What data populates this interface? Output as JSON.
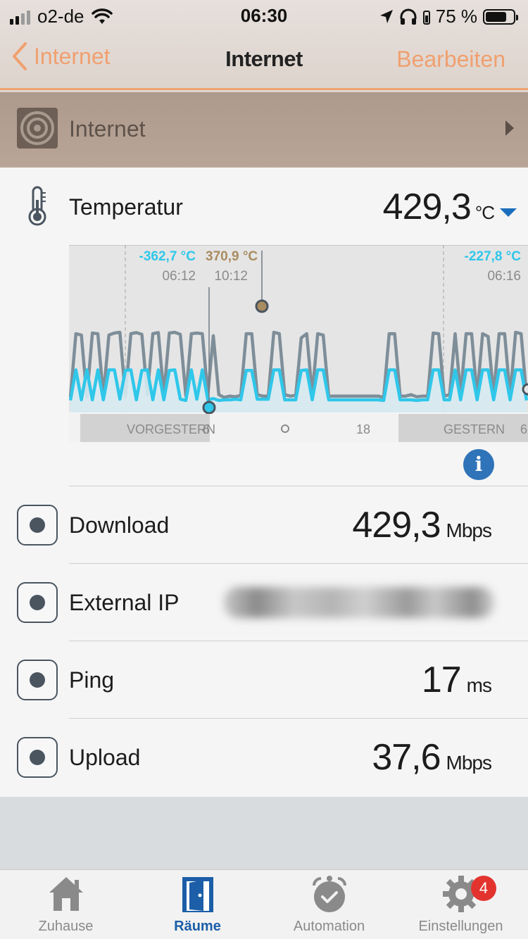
{
  "status_bar": {
    "carrier": "o2-de",
    "time": "06:30",
    "battery_percent": "75 %",
    "battery_level": 0.75
  },
  "nav": {
    "back_label": "Internet",
    "title": "Internet",
    "edit_label": "Bearbeiten"
  },
  "room": {
    "name": "Internet"
  },
  "temperature": {
    "label": "Temperatur",
    "value": "429,3",
    "unit": "°C"
  },
  "chart_data": {
    "type": "line",
    "markers": [
      {
        "value_label": "-362,7 °C",
        "time_label": "06:12",
        "color": "#2fc7ea"
      },
      {
        "value_label": "370,9 °C",
        "time_label": "10:12",
        "color": "#a98c60"
      },
      {
        "value_label": "-227,8 °C",
        "time_label": "06:16",
        "color": "#2fc7ea"
      }
    ],
    "timeline_labels": [
      "VORGESTERN",
      "6",
      "18",
      "GESTERN",
      "6"
    ],
    "series": [
      {
        "color": "#7e8e99",
        "values": [
          10,
          470,
          460,
          10,
          475,
          470,
          20,
          460,
          475,
          480,
          20,
          470,
          478,
          465,
          30,
          470,
          478,
          30,
          475,
          480,
          465,
          20,
          470,
          475,
          470,
          30,
          455,
          30,
          10,
          20,
          15,
          25,
          470,
          470,
          30,
          20,
          20,
          480,
          470,
          30,
          20,
          25,
          440,
          470,
          30,
          470,
          460,
          20,
          20,
          20,
          20,
          20,
          20,
          20,
          20,
          20,
          20,
          10,
          470,
          470,
          20,
          20,
          30,
          15,
          20,
          20,
          475,
          470,
          20,
          30,
          470,
          30,
          470,
          470,
          20,
          470,
          450,
          30,
          470,
          470,
          20,
          480,
          470,
          20
        ]
      },
      {
        "color": "#2fc7ea",
        "values": [
          30,
          520,
          40,
          520,
          40,
          520,
          40,
          520,
          520,
          50,
          510,
          520,
          40,
          510,
          520,
          40,
          520,
          40,
          510,
          520,
          50,
          30,
          520,
          50,
          520,
          40,
          60,
          30,
          40,
          40,
          50,
          40,
          510,
          510,
          50,
          50,
          50,
          520,
          520,
          40,
          40,
          40,
          510,
          520,
          40,
          520,
          520,
          40,
          40,
          40,
          40,
          40,
          40,
          40,
          40,
          40,
          40,
          30,
          520,
          520,
          40,
          40,
          40,
          30,
          40,
          40,
          520,
          520,
          40,
          40,
          520,
          40,
          520,
          520,
          40,
          520,
          520,
          40,
          520,
          520,
          40,
          520,
          520,
          30
        ]
      }
    ]
  },
  "rows": [
    {
      "label": "Download",
      "value": "429,3",
      "unit": "Mbps"
    },
    {
      "label": "External IP",
      "value": "",
      "unit": ""
    },
    {
      "label": "Ping",
      "value": "17",
      "unit": "ms"
    },
    {
      "label": "Upload",
      "value": "37,6",
      "unit": "Mbps"
    }
  ],
  "tabs": [
    {
      "label": "Zuhause",
      "icon": "house-icon"
    },
    {
      "label": "Räume",
      "icon": "door-icon"
    },
    {
      "label": "Automation",
      "icon": "alarm-clock-icon"
    },
    {
      "label": "Einstellungen",
      "icon": "gear-icon",
      "badge": "4"
    }
  ]
}
